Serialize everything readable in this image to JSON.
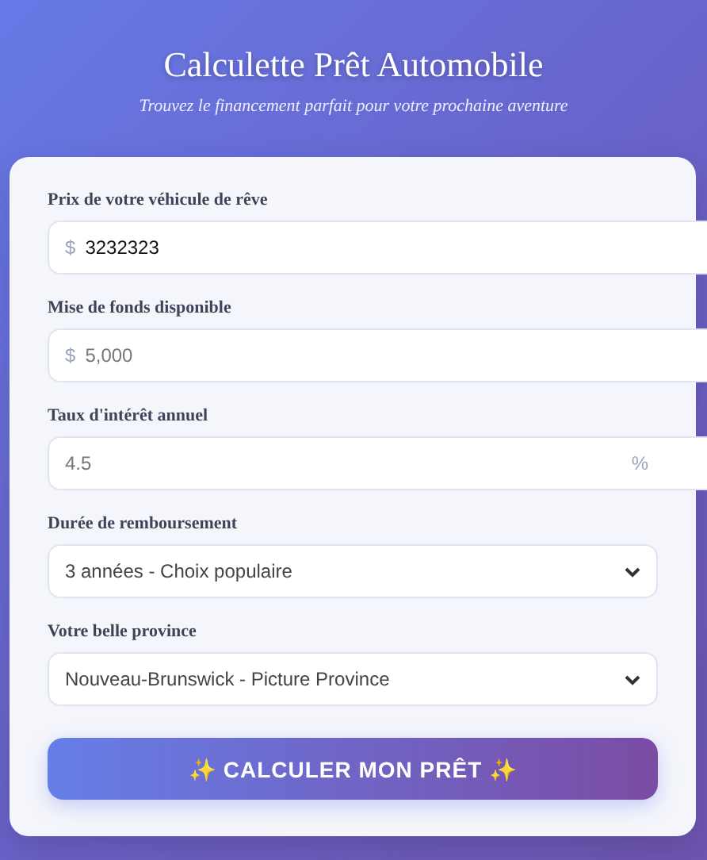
{
  "header": {
    "title": "Calculette Prêt Automobile",
    "subtitle": "Trouvez le financement parfait pour votre prochaine aventure"
  },
  "fields": [
    {
      "label": "Prix de votre véhicule de rêve",
      "kind": "input",
      "prefix": "$",
      "value": "3232323"
    },
    {
      "label": "Mise de fonds disponible",
      "kind": "input",
      "prefix": "$",
      "placeholder": "5,000"
    },
    {
      "label": "Taux d'intérêt annuel",
      "kind": "input",
      "suffix": "%",
      "placeholder": "4.5"
    },
    {
      "label": "Durée de remboursement",
      "kind": "select",
      "value": "3 années - Choix populaire"
    },
    {
      "label": "Votre belle province",
      "kind": "select",
      "value": "Nouveau-Brunswick - Picture Province"
    }
  ],
  "button": "✨ CALCULER MON PRÊT ✨"
}
